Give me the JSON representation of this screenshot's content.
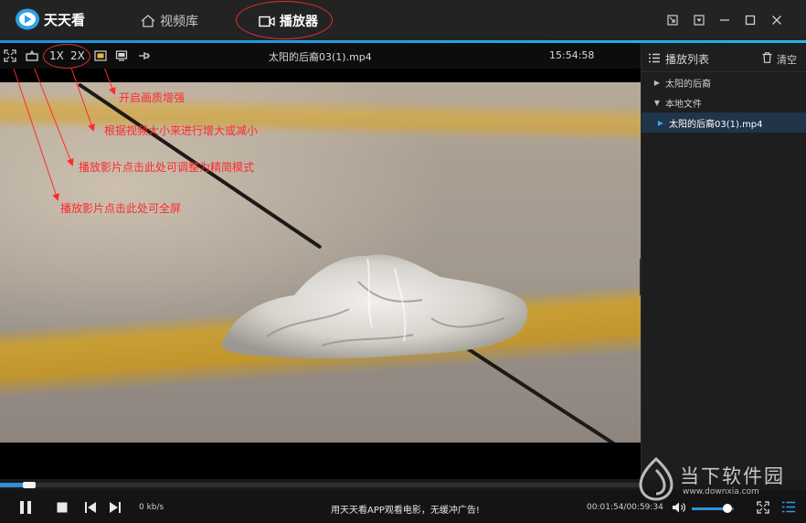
{
  "app": {
    "name": "天天看",
    "nav": [
      {
        "label": "视频库",
        "icon": "home-icon"
      },
      {
        "label": "播放器",
        "icon": "player-icon",
        "active": true
      }
    ],
    "window_buttons": [
      "mini-mode-icon",
      "menu-icon",
      "minimize-icon",
      "maximize-icon",
      "close-icon"
    ]
  },
  "toolbar": {
    "fullscreen_icon": "fullscreen-icon",
    "compact_icon": "compact-mode-icon",
    "speed_1x": "1X",
    "speed_2x": "2X",
    "enhance_icon": "image-enhance-icon",
    "screen_icon": "screen-icon",
    "pin_icon": "pin-icon",
    "file_title": "太阳的后裔03(1).mp4",
    "clock": "15:54:58"
  },
  "annotations": [
    "开启画质增强",
    "根据视频大小来进行增大或减小",
    "播放影片点击此处可调整为精简模式",
    "播放影片点击此处可全屏"
  ],
  "playlist": {
    "title": "播放列表",
    "clear": "清空",
    "groups": [
      {
        "label": "太阳的后裔",
        "expanded": false
      },
      {
        "label": "本地文件",
        "expanded": true
      }
    ],
    "items": [
      {
        "label": "太阳的后裔03(1).mp4",
        "active": true
      }
    ]
  },
  "player": {
    "progress": 0.045,
    "rate": "0 kb/s",
    "ad_text": "用天天看APP观看电影，无缓冲广告!",
    "time": "00:01:54/00:59:34",
    "volume": 0.85
  },
  "watermark": {
    "text": "当下软件园",
    "url": "www.downxia.com"
  },
  "colors": {
    "accent": "#2f8fd8",
    "annotation": "#ff2a2a",
    "background": "#1a1a1a"
  }
}
